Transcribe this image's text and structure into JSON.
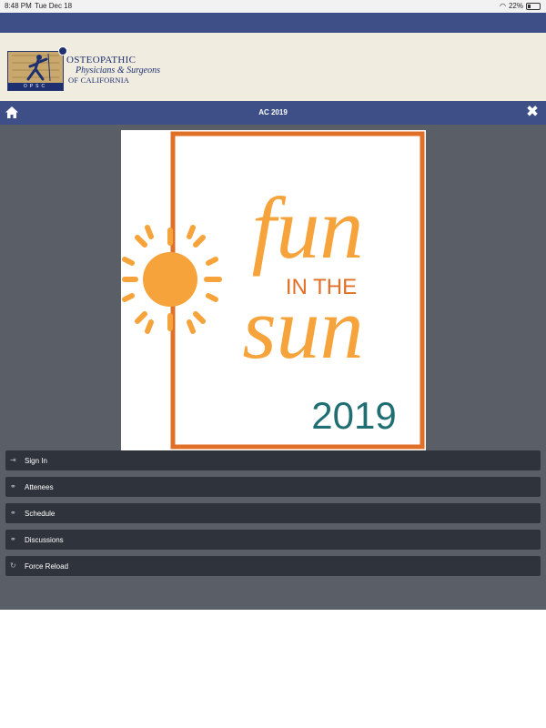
{
  "status_bar": {
    "time": "8:48 PM",
    "date": "Tue Dec 18",
    "battery": "22%"
  },
  "brand": {
    "org_line1": "OSTEOPATHIC",
    "org_line2": "Physicians & Surgeons",
    "org_line3": "OF CALIFORNIA",
    "logo_band_text": "OPSC"
  },
  "nav": {
    "title": "AC 2019",
    "home_icon": "home-icon",
    "close_icon": "close-icon"
  },
  "banner": {
    "headline_top": "fun",
    "headline_middle": "IN THE",
    "headline_bottom": "sun",
    "year": "2019"
  },
  "menu": {
    "items": [
      {
        "label": "Sign In",
        "icon": "sign-in-icon"
      },
      {
        "label": "Attenees",
        "icon": "link-icon"
      },
      {
        "label": "Schedule",
        "icon": "link-icon"
      },
      {
        "label": "Discussions",
        "icon": "link-icon"
      },
      {
        "label": "Force Reload",
        "icon": "reload-icon"
      }
    ]
  },
  "colors": {
    "nav_bg": "#3d4f86",
    "brand_bg": "#f0ece0",
    "content_bg": "#5a5e66",
    "menu_item_bg": "#2f333b",
    "sun_orange": "#f5a33a",
    "frame_orange": "#e06f28",
    "year_teal": "#1f6e72"
  }
}
